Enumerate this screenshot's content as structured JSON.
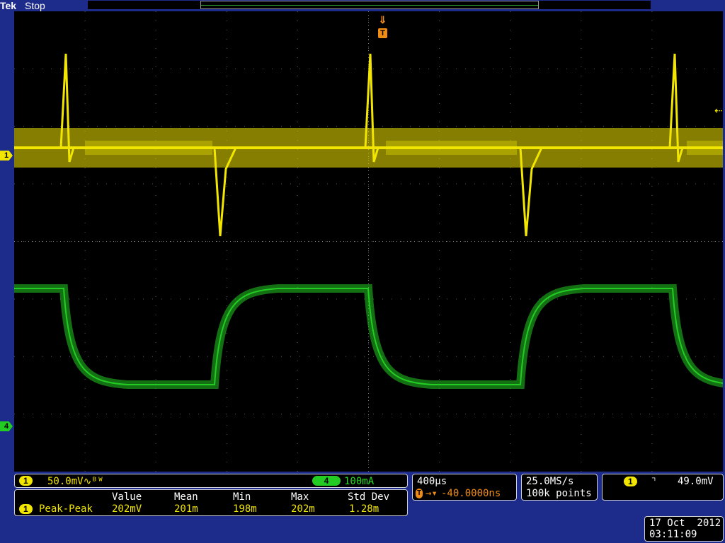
{
  "header": {
    "brand": "Tek",
    "status": "Stop"
  },
  "markers": {
    "trigger": "T",
    "ch1": "1",
    "ch4": "4"
  },
  "colors": {
    "ch1": "#f2e600",
    "ch4": "#22cc22",
    "trigger": "#f08c14",
    "frame": "#1d2b8a"
  },
  "channel1": {
    "badge": "1",
    "scale": "50.0mV∿ᴮᵂ"
  },
  "channel4": {
    "badge": "4",
    "scale": "100mA"
  },
  "measurements": {
    "headers": [
      "Value",
      "Mean",
      "Min",
      "Max",
      "Std Dev"
    ],
    "rows": [
      {
        "badge": "1",
        "name": "Peak-Peak",
        "value": "202mV",
        "mean": "201m",
        "min": "198m",
        "max": "202m",
        "std": "1.28m"
      }
    ]
  },
  "timebase": {
    "scale": "400µs",
    "position": "-40.0000ns"
  },
  "acquisition": {
    "rate": "25.0MS/s",
    "points": "100k points"
  },
  "trigger": {
    "source": "1",
    "slope": "falling",
    "level": "49.0mV"
  },
  "datetime": {
    "date": "17 Oct  2012",
    "time": "03:11:09"
  }
}
